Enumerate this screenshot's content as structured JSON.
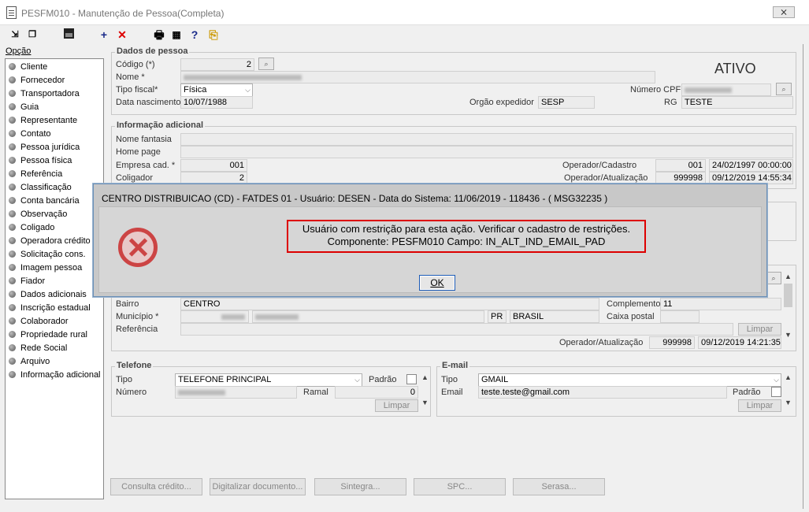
{
  "window": {
    "title": "PESFM010 - Manutenção de Pessoa(Completa)",
    "close": "⨯"
  },
  "toolbar": {
    "add": "+",
    "delete": "✕",
    "help": "?"
  },
  "sidebar": {
    "label": "Opção",
    "items": [
      "Cliente",
      "Fornecedor",
      "Transportadora",
      "Guia",
      "Representante",
      "Contato",
      "Pessoa jurídica",
      "Pessoa física",
      "Referência",
      "Classificação",
      "Conta bancária",
      "Observação",
      "Coligado",
      "Operadora crédito",
      "Solicitação cons.",
      "Imagem pessoa",
      "Fiador",
      "Dados adicionais",
      "Inscrição estadual",
      "Colaborador",
      "Propriedade rural",
      "Rede Social",
      "Arquivo",
      "Informação adicional"
    ]
  },
  "dados": {
    "title": "Dados de pessoa",
    "codigo_label": "Código (*)",
    "codigo": "2",
    "nome_label": "Nome *",
    "tipo_fiscal_label": "Tipo fiscal*",
    "tipo_fiscal": "Física",
    "data_nasc_label": "Data nascimento",
    "data_nasc": "10/07/1988",
    "status": "ATIVO",
    "cpf_label": "Número CPF",
    "orgao_label": "Orgão expedidor",
    "orgao": "SESP",
    "rg_label": "RG",
    "rg": "TESTE"
  },
  "info": {
    "title": "Informação adicional",
    "fantasia_label": "Nome fantasia",
    "homepage_label": "Home page",
    "empresa_label": "Empresa cad. *",
    "empresa": "001",
    "coligador_label": "Coligador",
    "coligador": "2",
    "op_cad_label": "Operador/Cadastro",
    "op_cad": "001",
    "op_cad_date": "24/02/1997 00:00:00",
    "op_at_label": "Operador/Atualização",
    "op_at": "999998",
    "op_at_date": "09/12/2019 14:55:34"
  },
  "endereco": {
    "bairro_label": "Bairro",
    "bairro": "CENTRO",
    "municipio_label": "Município *",
    "uf": "PR",
    "pais": "BRASIL",
    "referencia_label": "Referência",
    "complemento_label": "Complemento",
    "complemento": "11",
    "caixa_label": "Caixa postal",
    "limpar": "Limpar",
    "op_at_label": "Operador/Atualização",
    "op_at": "999998",
    "op_at_date": "09/12/2019 14:21:35"
  },
  "telefone": {
    "title": "Telefone",
    "tipo_label": "Tipo",
    "tipo": "TELEFONE PRINCIPAL",
    "padrao_label": "Padrão",
    "numero_label": "Número",
    "ramal_label": "Ramal",
    "ramal": "0",
    "limpar": "Limpar"
  },
  "email": {
    "title": "E-mail",
    "tipo_label": "Tipo",
    "tipo": "GMAIL",
    "email_label": "Email",
    "email": "teste.teste@gmail.com",
    "padrao_label": "Padrão",
    "limpar": "Limpar"
  },
  "bottom_buttons": [
    "Consulta crédito...",
    "Digitalizar documento...",
    "Sintegra...",
    "SPC...",
    "Serasa..."
  ],
  "dialog": {
    "title": "CENTRO DISTRIBUICAO (CD) - FATDES 01 - Usuário: DESEN - Data do Sistema: 11/06/2019 - 118436 - ( MSG32235 )",
    "line1": "Usuário com restrição para esta ação. Verificar o cadastro de restrições.",
    "line2": "Componente: PESFM010 Campo: IN_ALT_IND_EMAIL_PAD",
    "ok": "OK"
  }
}
